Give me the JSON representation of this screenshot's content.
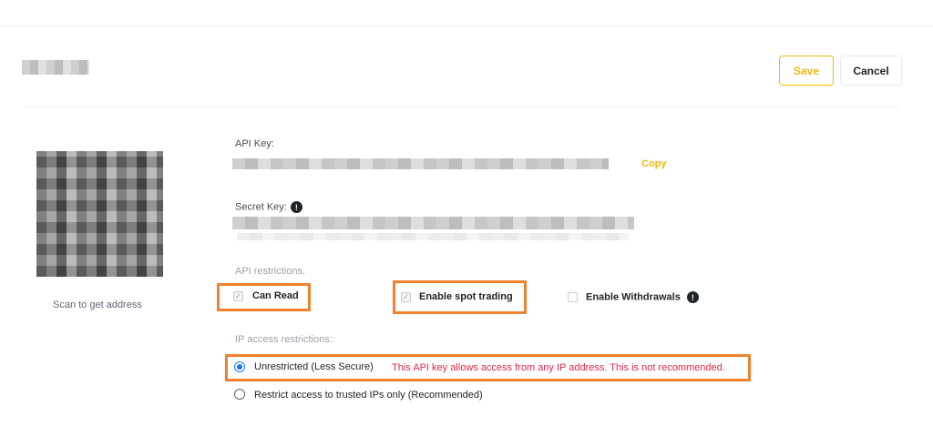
{
  "header": {
    "save_label": "Save",
    "cancel_label": "Cancel"
  },
  "qr": {
    "caption": "Scan to get address"
  },
  "api_key": {
    "label": "API Key:",
    "copy_label": "Copy"
  },
  "secret_key": {
    "label": "Secret Key:",
    "info_icon": "exclamation-circle-icon"
  },
  "restrictions": {
    "label": "API restrictions.",
    "options": [
      {
        "label": "Can Read",
        "checked": true,
        "disabled": true
      },
      {
        "label": "Enable spot trading",
        "checked": true,
        "disabled": true
      },
      {
        "label": "Enable Withdrawals",
        "checked": false,
        "disabled": false
      }
    ]
  },
  "ip": {
    "label": "IP access restrictions::",
    "options": [
      {
        "label": "Unrestricted (Less Secure)",
        "selected": true
      },
      {
        "label": "Restrict access to trusted IPs only (Recommended)",
        "selected": false
      }
    ],
    "warning": "This API key allows access from any IP address. This is not recommended."
  },
  "colors": {
    "accent": "#f0b90b",
    "highlight": "#f0812e",
    "warning": "#e0284a",
    "radio": "#1a73e8"
  }
}
